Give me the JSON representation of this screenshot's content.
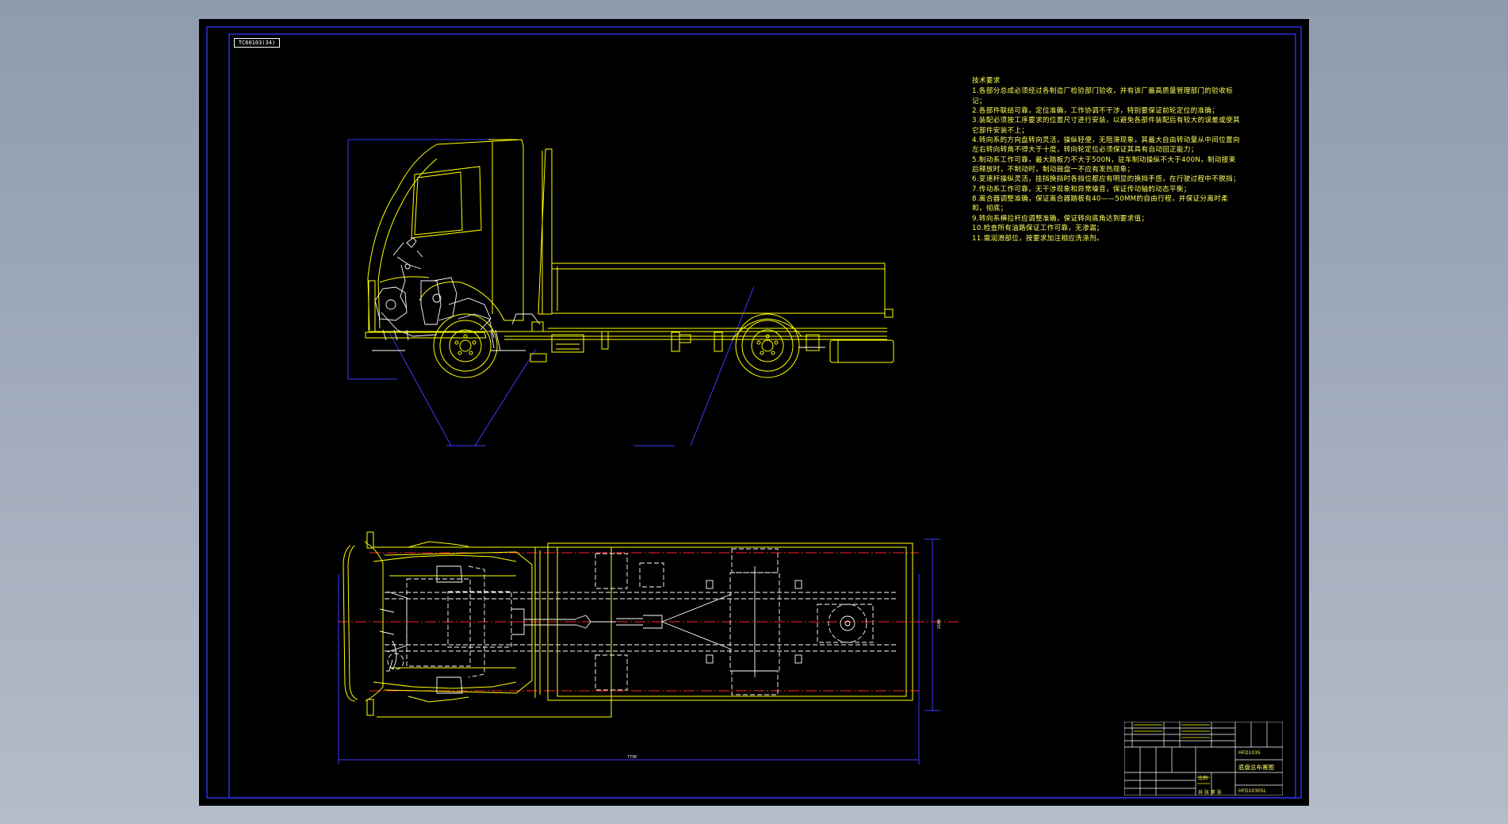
{
  "drawing": {
    "tag_number": "TC60103(34)",
    "colors": {
      "background": "#000000",
      "frame": "#2b3bff",
      "outline": "#ffff00",
      "detail": "#ffffff",
      "centerline": "#ff2020",
      "text": "#ffff5a"
    },
    "views": [
      "side-elevation",
      "plan-view"
    ]
  },
  "tech_requirements": {
    "title": "技术要求",
    "items": [
      "1.各部分总成必须经过各制造厂检验部门验收，并有该厂最高质量管理部门的验收标记；",
      "2.各部件联结可靠，定位准确，工作协调不干涉，特别要保证前轮定位的准确；",
      "3.装配必须按工序要求的位置尺寸进行安装，以避免各部件装配后有较大的误差或使其它部件安装不上；",
      "4.转向系的方向盘转向灵活，操纵轻便，无阻滞现象，其最大自由转动量从中间位置向左右转向转角不得大于十度，转向轮定位必须保证其具有自动回正能力；",
      "5.制动系工作可靠，最大踏板力不大于500N，驻车制动操纵不大于400N，制动接束后释放时，不制动时，制动鼓盘一不应有发热现象；",
      "6.变速杆操纵灵活，挂挡换挡时各挡位都应有明显的换挡手感，在行驶过程中不脱挡；",
      "7.传动系工作可靠，无干涉现象和异常噪音，保证传动轴的动态平衡；",
      "8.离合器调整准确，保证离合器踏板有40——50MM的自由行程，并保证分离时柔和，彻底；",
      "9.转向系横拉杆应调整准确，保证转向底角达到要求值；",
      "10.检查所有油路保证工作可靠，无渗漏；",
      "11.需润滑部位，按要求加注相应洗涤剂。"
    ]
  },
  "title_block": {
    "drawing_name": "底盘总布置图",
    "drawing_number": "HFD10305L",
    "school": "HFD1035",
    "scale_label": "比例",
    "sheet_label": "共 张 第 张"
  }
}
